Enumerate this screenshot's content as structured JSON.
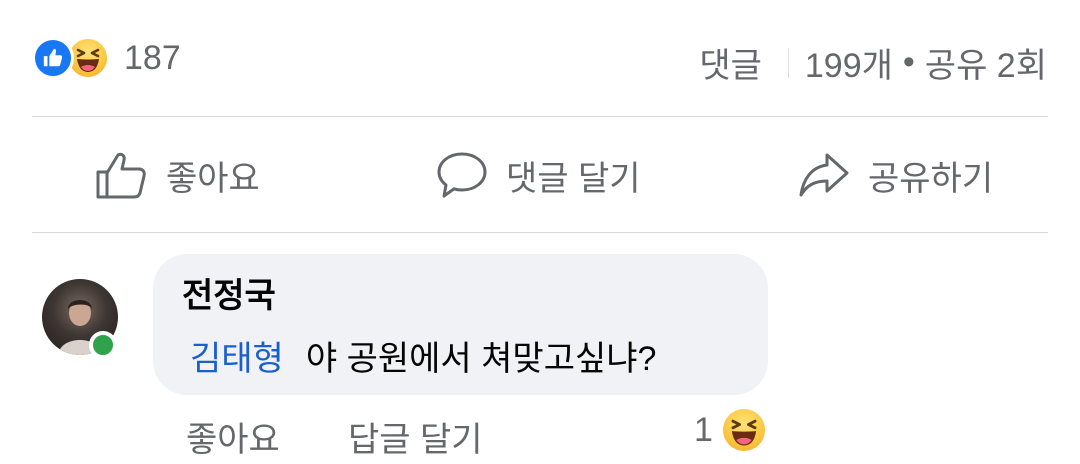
{
  "summary": {
    "reaction_count": "187",
    "comments_label": "댓글",
    "comments_count": "199개",
    "separator_dot": "•",
    "shares": "공유 2회"
  },
  "actions": {
    "like": "좋아요",
    "comment": "댓글 달기",
    "share": "공유하기"
  },
  "comment": {
    "author": "전정국",
    "mention": "김태형",
    "text": "야 공원에서 쳐맞고싶냐?",
    "like_label": "좋아요",
    "reply_label": "답글 달기",
    "reaction_count": "1"
  },
  "colors": {
    "like_blue": "#1877f2",
    "mention_blue": "#1b5fcf",
    "online_green": "#31a24c",
    "muted_text": "#65676b",
    "bubble_bg": "#f0f2f5"
  },
  "icons": [
    "like-reaction-icon",
    "haha-reaction-icon",
    "thumbs-up-icon",
    "comment-icon",
    "share-icon",
    "online-status-icon"
  ]
}
